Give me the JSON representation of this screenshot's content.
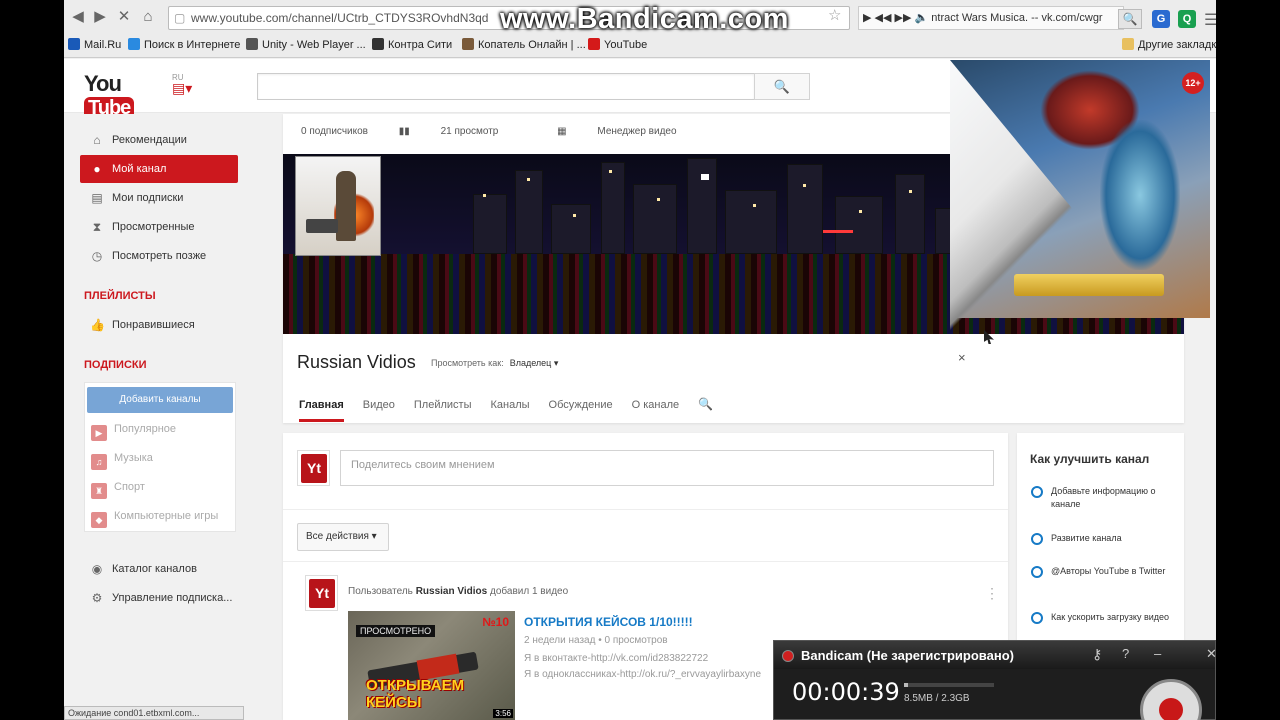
{
  "watermark": "www.Bandicam.com",
  "browser": {
    "url": "www.youtube.com/channel/UCtrb_CTDYS3ROvhdN3qd",
    "ext_text": "ntract Wars Musica. -- vk.com/cwgr",
    "bookmarks": [
      "Mail.Ru",
      "Поиск в Интернете",
      "Unity - Web Player ...",
      "Контра Сити",
      "Копатель Онлайн | ...",
      "YouTube"
    ],
    "other_bookmarks": "Другие закладки",
    "status_text": "Ожидание cond01.etbxml.com..."
  },
  "header": {
    "logo_you": "You",
    "logo_tube": "Tube",
    "logo_region": "RU"
  },
  "sidebar": {
    "items": [
      {
        "label": "Рекомендации",
        "icon": "⌂"
      },
      {
        "label": "Мой канал",
        "icon": "●"
      },
      {
        "label": "Мои подписки",
        "icon": "▤"
      },
      {
        "label": "Просмотренные",
        "icon": "⧗"
      },
      {
        "label": "Посмотреть позже",
        "icon": "◷"
      }
    ],
    "playlists_heading": "ПЛЕЙЛИСТЫ",
    "liked": "Понравившиеся",
    "subs_heading": "ПОДПИСКИ",
    "add_channels": "Добавить каналы",
    "subscriptions": [
      "Популярное",
      "Музыка",
      "Спорт",
      "Компьютерные игры"
    ],
    "catalog": "Каталог каналов",
    "manage": "Управление подписка..."
  },
  "channel": {
    "subscribers": "0 подписчиков",
    "views": "21 просмотр",
    "video_manager": "Менеджер видео",
    "name": "Russian Vidios",
    "view_as_label": "Просмотреть как:",
    "view_as_value": "Владелец ▾",
    "tabs": [
      "Главная",
      "Видео",
      "Плейлисты",
      "Каналы",
      "Обсуждение",
      "О канале"
    ]
  },
  "feed": {
    "share_placeholder": "Поделитесь своим мнением",
    "actions_label": "Все действия ▾",
    "activity_prefix": "Пользователь",
    "activity_user": "Russian Vidios",
    "activity_suffix": "добавил 1 видео",
    "video": {
      "title": "ОТКРЫТИЯ КЕЙСОВ 1/10!!!!!",
      "meta": "2 недели назад • 0 просмотров",
      "desc1": "Я в вконтакте-http://vk.com/id283822722",
      "desc2": "Я в одноклассниках-http://ok.ru/?_ervvayaylirbaxyne",
      "thumb_tag": "ПРОСМОТРЕНО",
      "thumb_caption": "ОТКРЫВАЕМ КЕЙСЫ",
      "thumb_number": "№10",
      "duration": "3:56"
    }
  },
  "improve": {
    "title": "Как улучшить канал",
    "tips": [
      "Добавьте информацию о канале",
      "Развитие канала",
      "@Авторы YouTube в Twitter",
      "Как ускорить загрузку видео"
    ]
  },
  "ad": {
    "age": "12+",
    "close": "×"
  },
  "bandicam": {
    "title": "Bandicam (Не зарегистрировано)",
    "timer": "00:00:39",
    "size": "8.5MB / 2.3GB",
    "progress_pct": 4
  }
}
